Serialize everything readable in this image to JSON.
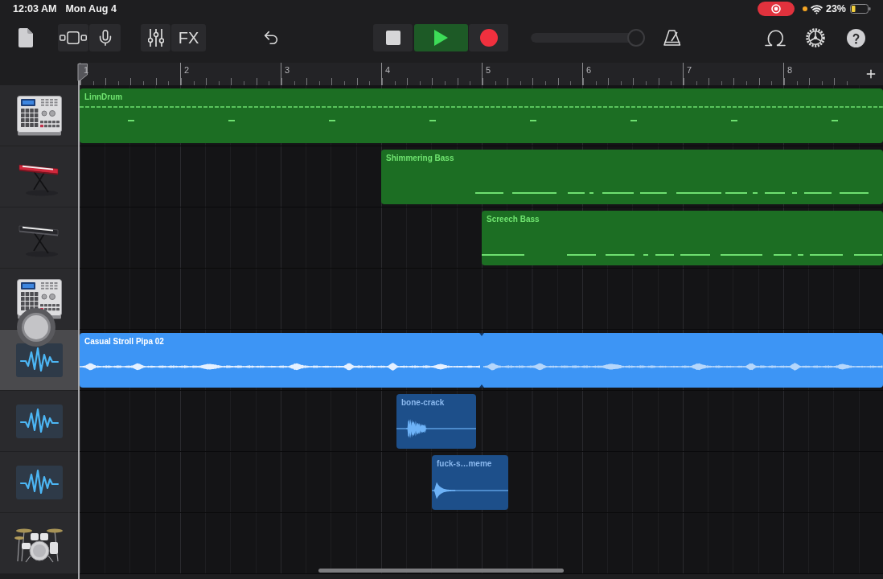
{
  "status_bar": {
    "time": "12:03 AM",
    "date": "Mon Aug 4",
    "battery": "23%"
  },
  "toolbar": {
    "fx": "FX",
    "playing": true,
    "volume": {
      "level": 0.92
    }
  },
  "ruler": {
    "bars": [
      "1",
      "2",
      "3",
      "4",
      "5",
      "6",
      "7",
      "8"
    ]
  },
  "tracks": [
    {
      "kind": "drum-machine",
      "selected": false,
      "regions": [
        {
          "kind": "midi",
          "name": "LinnDrum"
        }
      ]
    },
    {
      "kind": "synth",
      "selected": false,
      "regions": [
        {
          "kind": "midi",
          "name": "Shimmering Bass"
        }
      ]
    },
    {
      "kind": "keyboard",
      "selected": false,
      "regions": [
        {
          "kind": "midi",
          "name": "Screech Bass"
        }
      ]
    },
    {
      "kind": "drum-machine",
      "selected": false
    },
    {
      "kind": "audio",
      "selected": true,
      "regions": [
        {
          "kind": "audio",
          "name": "Casual Stroll Pipa 02"
        }
      ]
    },
    {
      "kind": "audio",
      "selected": false,
      "regions": [
        {
          "kind": "audio",
          "name": "bone-crack"
        }
      ]
    },
    {
      "kind": "audio",
      "selected": false,
      "regions": [
        {
          "kind": "audio",
          "name": "fuck-s…meme"
        }
      ]
    },
    {
      "kind": "drums",
      "selected": false
    }
  ]
}
